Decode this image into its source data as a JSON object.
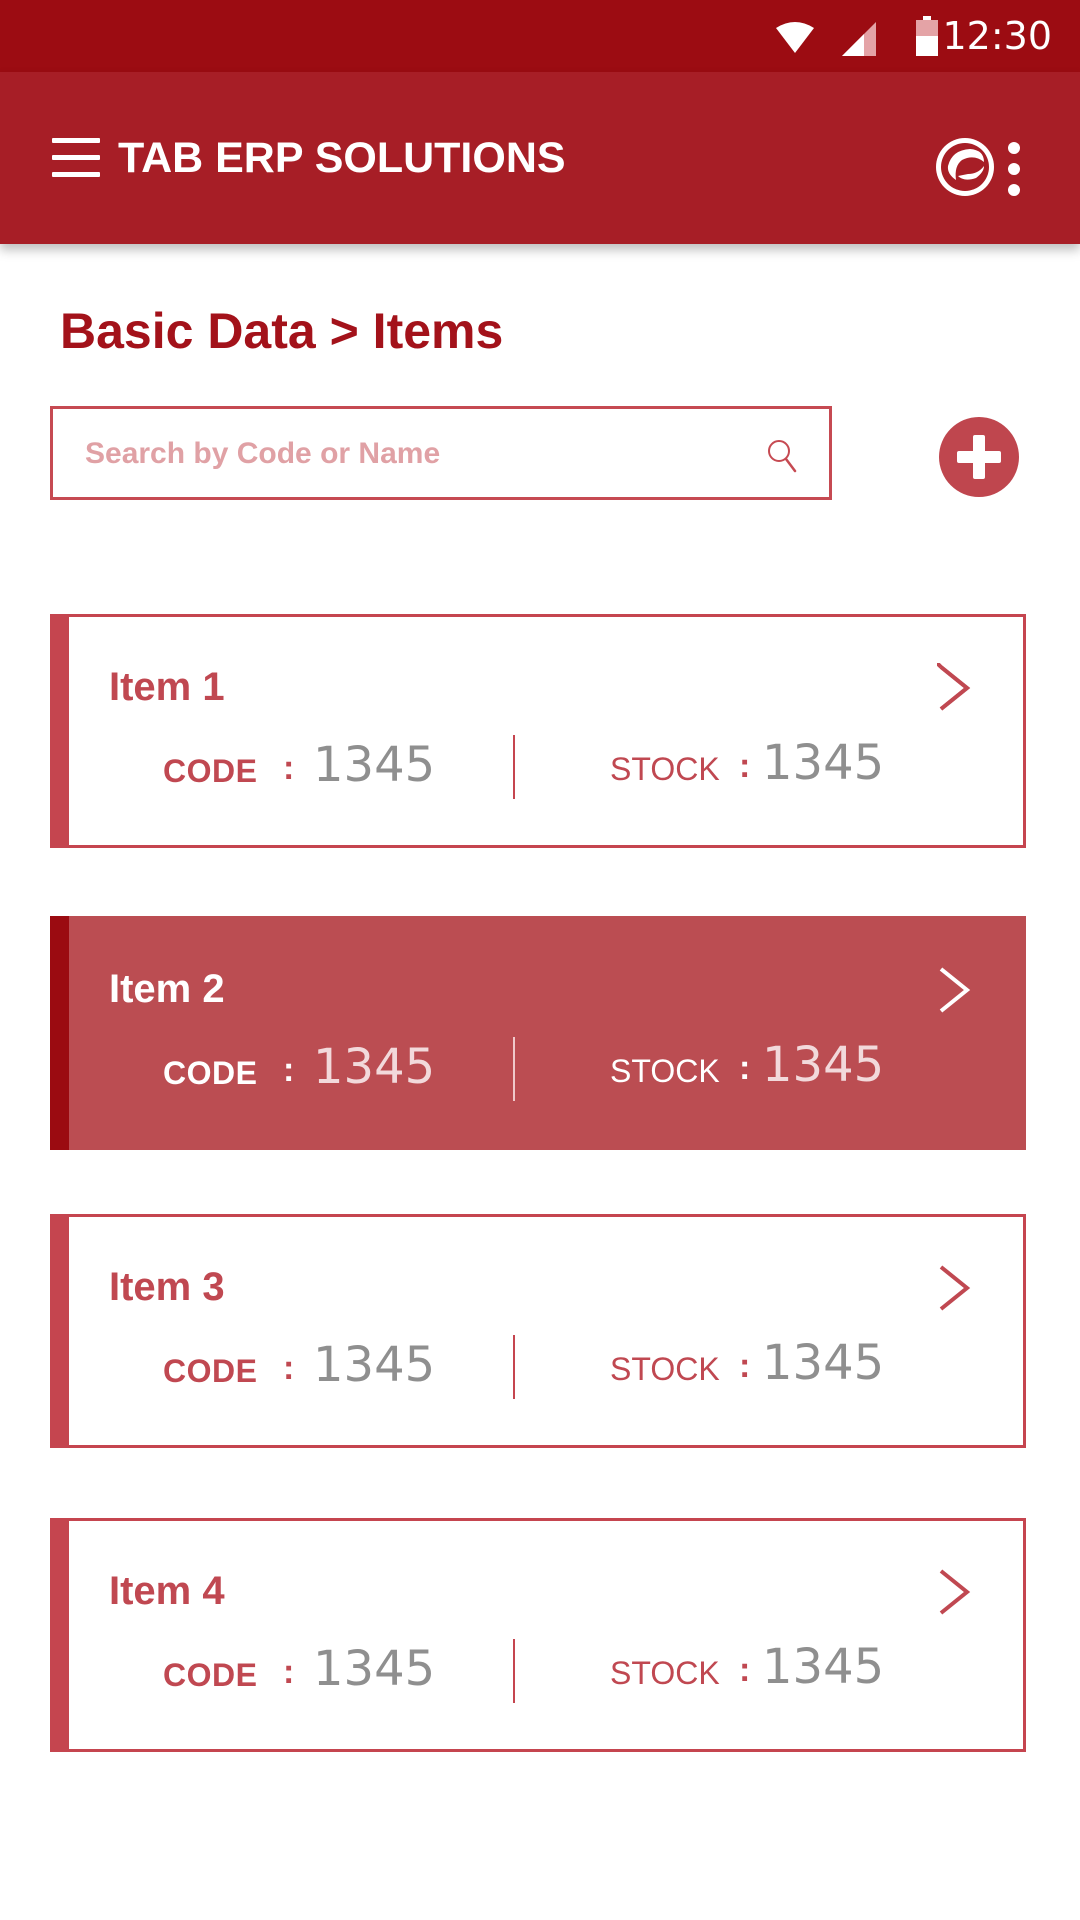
{
  "status_bar": {
    "time": "12:30"
  },
  "app_bar": {
    "title": "TAB ERP SOLUTIONS",
    "menu_icon": "hamburger-menu-icon",
    "logo_icon": "app-logo-icon",
    "more_icon": "more-vert-icon"
  },
  "breadcrumb": "Basic Data > Items",
  "search": {
    "placeholder": "Search by Code or Name",
    "value": ""
  },
  "colors": {
    "primary": "#a71e26",
    "status_bar": "#9c0c12",
    "accent": "#c5454f",
    "selected_card": "#bb4d52",
    "value_gray": "#8f8f8f"
  },
  "items": [
    {
      "name": "Item 1",
      "code_label": "CODE",
      "code_colon": ":",
      "code": "1345",
      "stock_label": "STOCK",
      "stock_colon": ":",
      "stock": "1345"
    },
    {
      "name": "Item 2",
      "code_label": "CODE",
      "code_colon": ":",
      "code": "1345",
      "stock_label": "STOCK",
      "stock_colon": ":",
      "stock": "1345",
      "selected": true
    },
    {
      "name": "Item 3",
      "code_label": "CODE",
      "code_colon": ":",
      "code": "1345",
      "stock_label": "STOCK",
      "stock_colon": ":",
      "stock": "1345"
    },
    {
      "name": "Item 4",
      "code_label": "CODE",
      "code_colon": ":",
      "code": "1345",
      "stock_label": "STOCK",
      "stock_colon": ":",
      "stock": "1345"
    }
  ]
}
